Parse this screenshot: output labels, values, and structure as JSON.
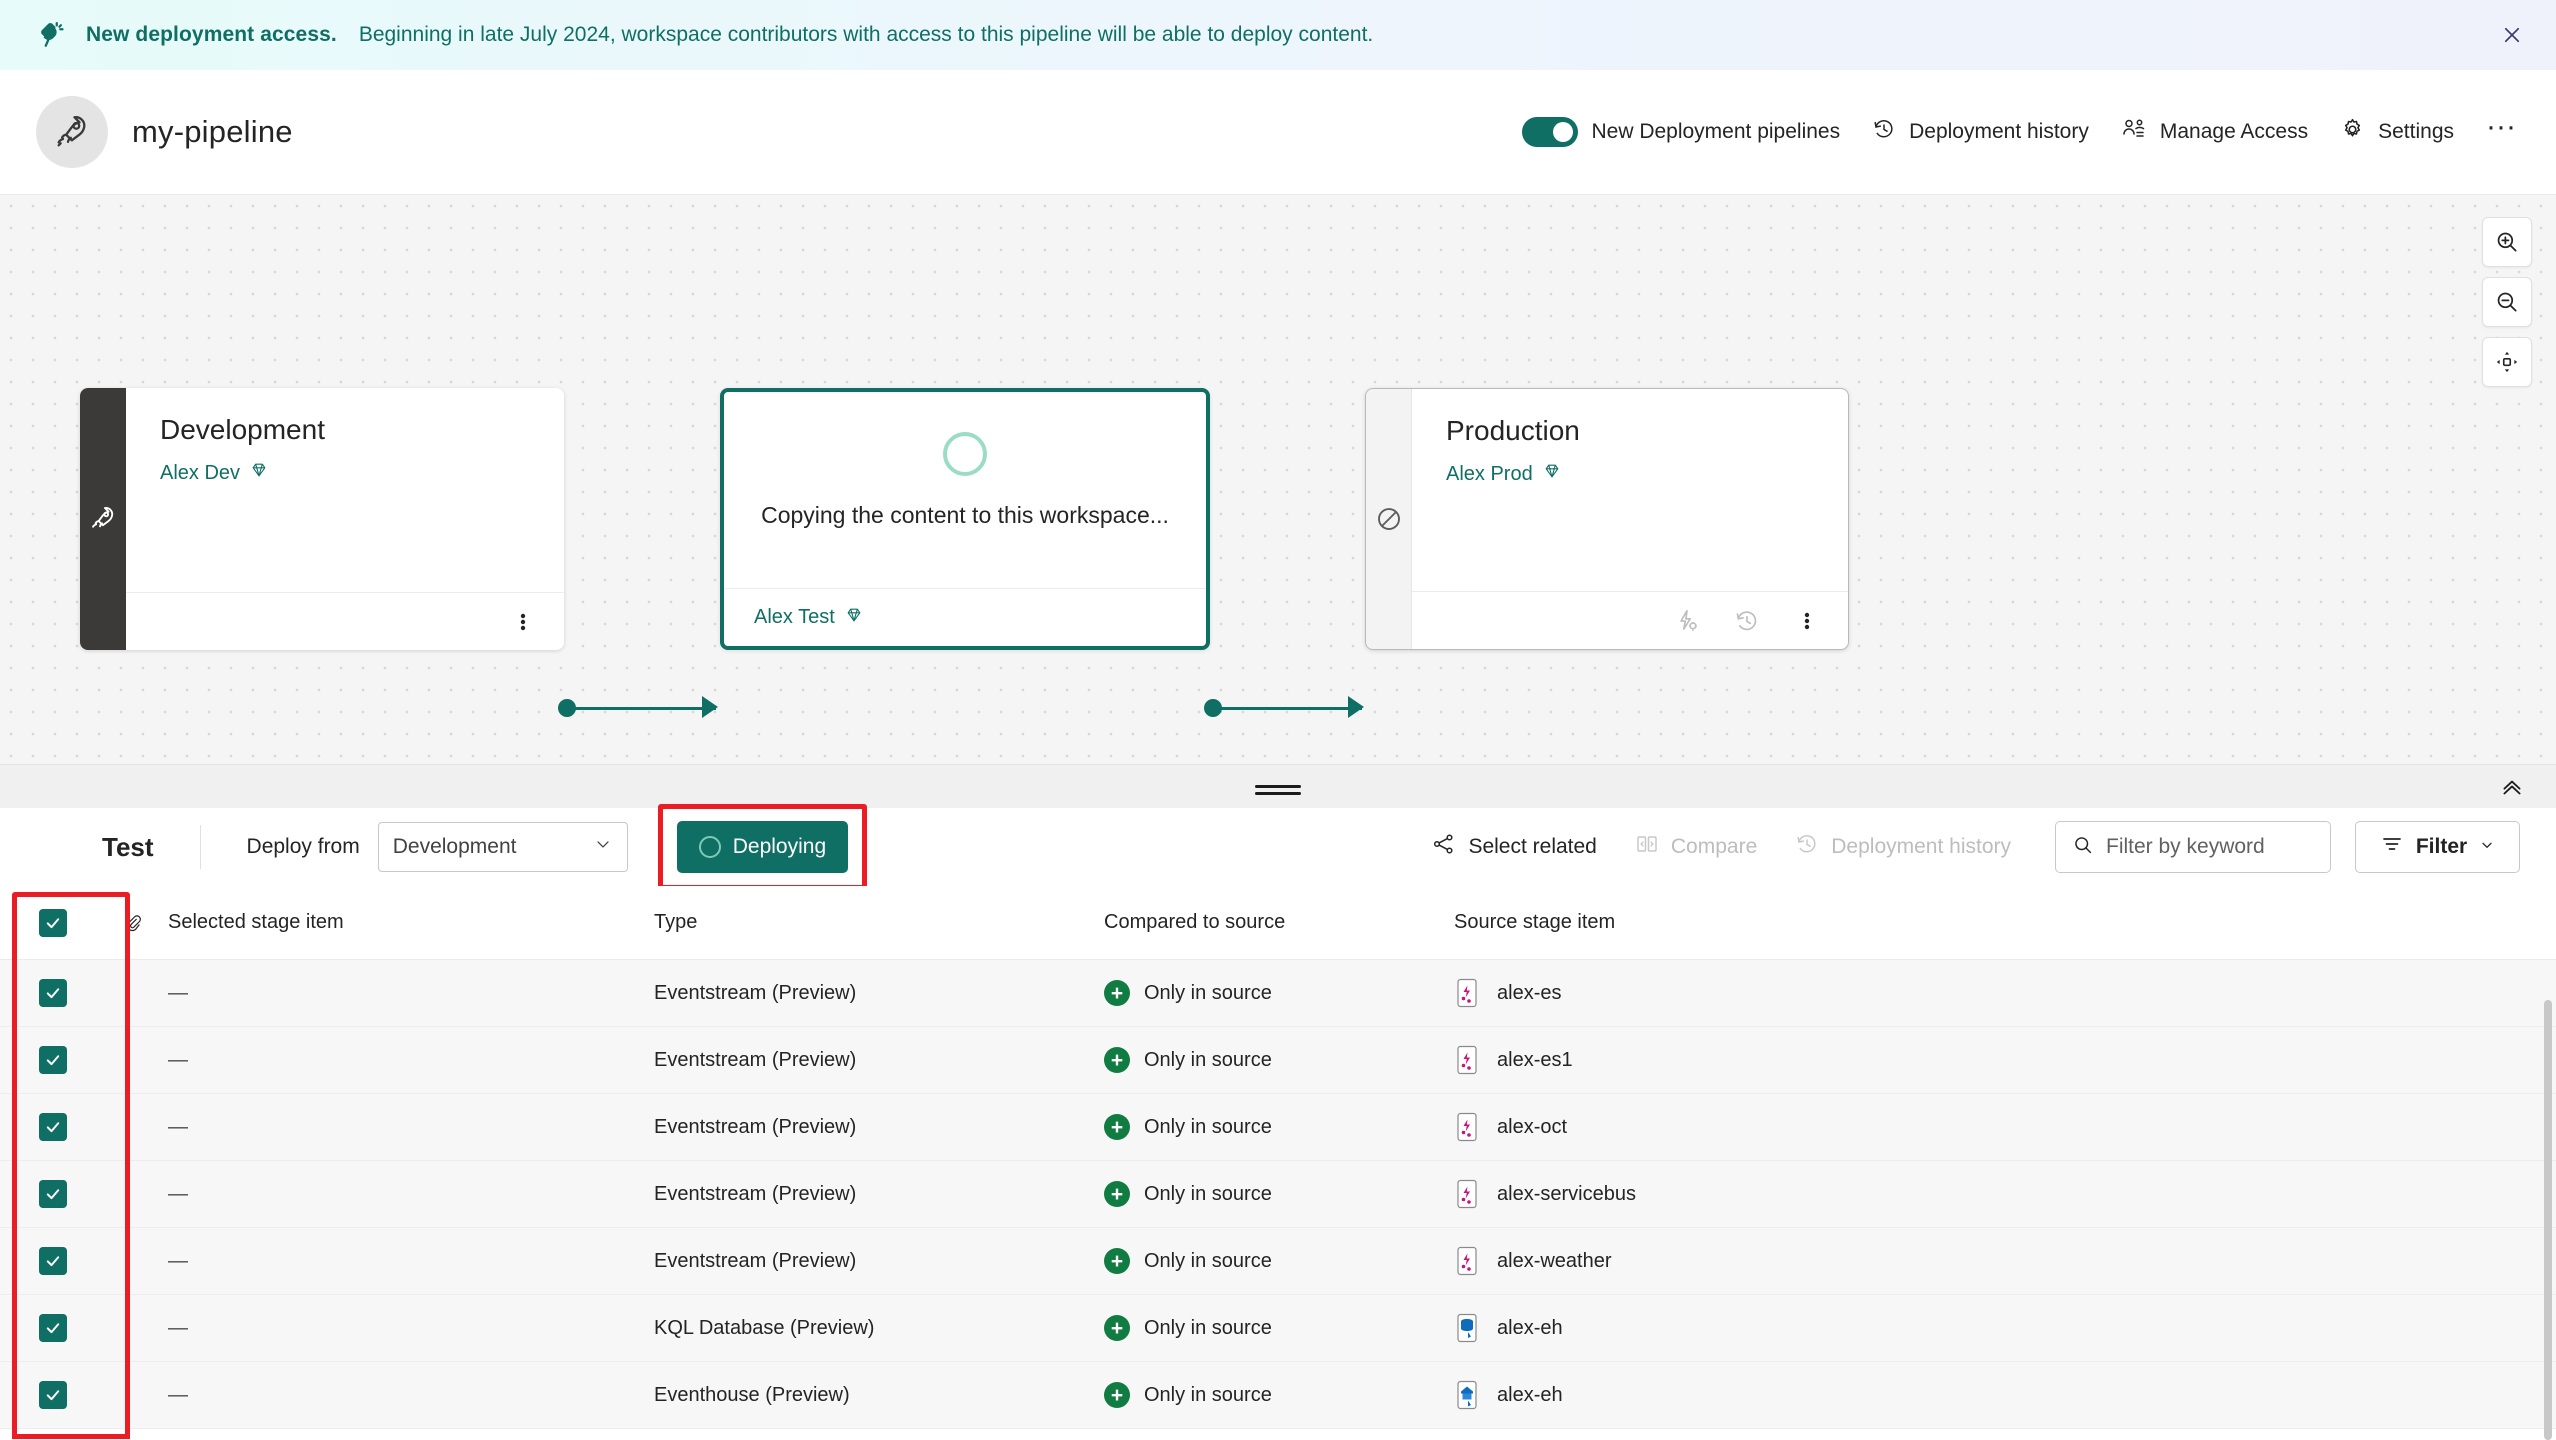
{
  "banner": {
    "icon": "megaphone-icon",
    "title": "New deployment access.",
    "message": "Beginning in late July 2024, workspace contributors with access to this pipeline will be able to deploy content.",
    "close_label": "×",
    "accent_color": "#0f6f64"
  },
  "header": {
    "avatar_icon": "rocket-icon",
    "title": "my-pipeline",
    "toggle": {
      "label": "New Deployment pipelines",
      "on": true,
      "color": "#0f6f64"
    },
    "actions": [
      {
        "icon": "history-icon",
        "label": "Deployment history"
      },
      {
        "icon": "people-icon",
        "label": "Manage Access"
      },
      {
        "icon": "gear-icon",
        "label": "Settings"
      }
    ],
    "overflow_label": "···"
  },
  "canvas": {
    "zoom_controls": [
      {
        "icon": "zoom-in-icon",
        "name": "zoom-in"
      },
      {
        "icon": "zoom-out-icon",
        "name": "zoom-out"
      },
      {
        "icon": "fit-to-screen-icon",
        "name": "fit-to-screen"
      }
    ],
    "stages": [
      {
        "name": "Development",
        "workspace": "Alex Dev",
        "workspace_badge_icon": "diamond-icon",
        "rail_icon": "rocket-icon",
        "status": "idle",
        "footer_icons": [
          "more-options-icon"
        ]
      },
      {
        "name": "",
        "status_text": "Copying the content to this workspace...",
        "workspace": "Alex Test",
        "workspace_badge_icon": "diamond-icon",
        "rail_icon": "spinner-icon",
        "status": "deploying",
        "footer_icons": []
      },
      {
        "name": "Production",
        "workspace": "Alex Prod",
        "workspace_badge_icon": "diamond-icon",
        "rail_icon": "blocked-icon",
        "status": "blocked",
        "footer_icons": [
          "deployment-rules-icon",
          "history-icon",
          "more-options-icon"
        ]
      }
    ]
  },
  "splitter": {
    "grip": "drag-handle",
    "collapse_icon": "chevron-double-up-icon"
  },
  "detail_toolbar": {
    "stage_label": "Test",
    "deploy_from_label": "Deploy from",
    "deploy_from_value": "Development",
    "deploy_button": {
      "label": "Deploying",
      "state": "in-progress",
      "color": "#0f6f64",
      "highlighted": true
    },
    "right_actions": [
      {
        "icon": "share-nodes-icon",
        "label": "Select related",
        "disabled": false
      },
      {
        "icon": "compare-icon",
        "label": "Compare",
        "disabled": true
      },
      {
        "icon": "history-icon",
        "label": "Deployment history",
        "disabled": true
      }
    ],
    "search": {
      "icon": "search-icon",
      "placeholder": "Filter by keyword",
      "value": ""
    },
    "filter": {
      "icon": "filter-icon",
      "label": "Filter",
      "chevron": "chevron-down-icon"
    }
  },
  "table": {
    "headers": {
      "select_all": "select-all-checkbox",
      "attach": "paperclip-icon",
      "selected_stage_item": "Selected stage item",
      "type": "Type",
      "compared_to_source": "Compared to source",
      "source_stage_item": "Source stage item"
    },
    "highlight_color": "#ec1c24",
    "rows": [
      {
        "checked": true,
        "selected_stage_item": "—",
        "type": "Eventstream (Preview)",
        "compared_to_source": "Only in source",
        "source_stage_item": "alex-es",
        "source_icon": "eventstream-icon"
      },
      {
        "checked": true,
        "selected_stage_item": "—",
        "type": "Eventstream (Preview)",
        "compared_to_source": "Only in source",
        "source_stage_item": "alex-es1",
        "source_icon": "eventstream-icon"
      },
      {
        "checked": true,
        "selected_stage_item": "—",
        "type": "Eventstream (Preview)",
        "compared_to_source": "Only in source",
        "source_stage_item": "alex-oct",
        "source_icon": "eventstream-icon"
      },
      {
        "checked": true,
        "selected_stage_item": "—",
        "type": "Eventstream (Preview)",
        "compared_to_source": "Only in source",
        "source_stage_item": "alex-servicebus",
        "source_icon": "eventstream-icon"
      },
      {
        "checked": true,
        "selected_stage_item": "—",
        "type": "Eventstream (Preview)",
        "compared_to_source": "Only in source",
        "source_stage_item": "alex-weather",
        "source_icon": "eventstream-icon"
      },
      {
        "checked": true,
        "selected_stage_item": "—",
        "type": "KQL Database (Preview)",
        "compared_to_source": "Only in source",
        "source_stage_item": "alex-eh",
        "source_icon": "kql-database-icon"
      },
      {
        "checked": true,
        "selected_stage_item": "—",
        "type": "Eventhouse (Preview)",
        "compared_to_source": "Only in source",
        "source_stage_item": "alex-eh",
        "source_icon": "eventhouse-icon"
      }
    ]
  }
}
